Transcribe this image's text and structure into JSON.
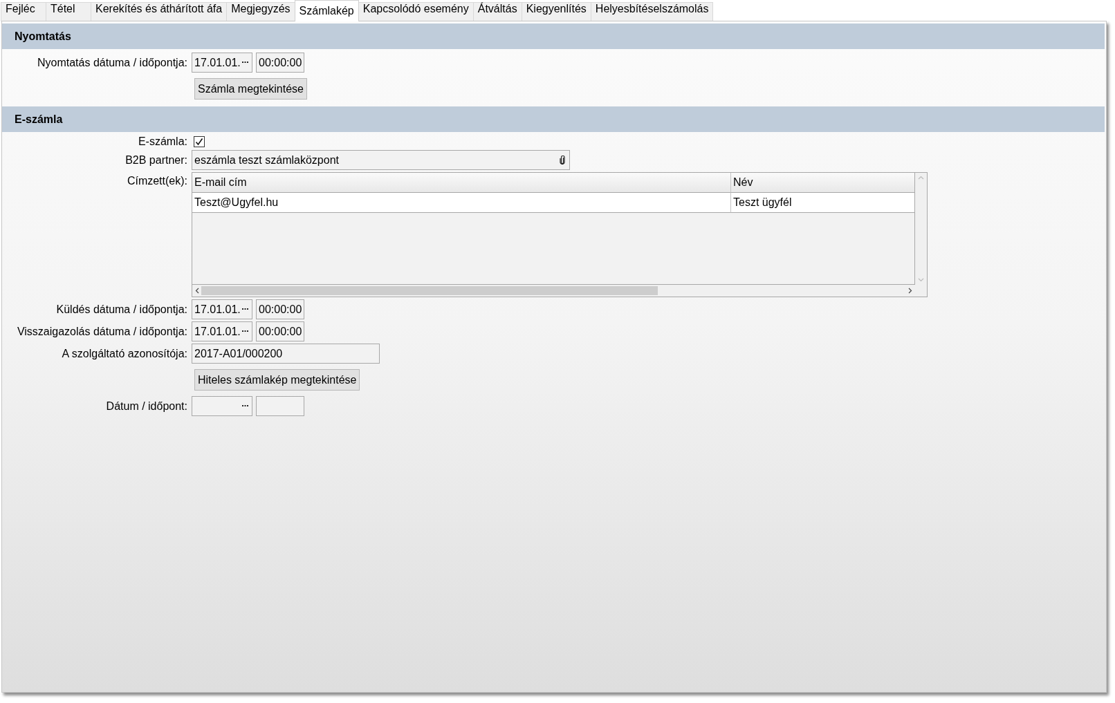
{
  "tabs": [
    {
      "label": "Fejléc",
      "selected": false
    },
    {
      "label": "Tétel",
      "selected": false
    },
    {
      "label": "Kerekítés és áthárított áfa",
      "selected": false
    },
    {
      "label": "Megjegyzés",
      "selected": false
    },
    {
      "label": "Számlakép",
      "selected": true
    },
    {
      "label": "Kapcsolódó esemény",
      "selected": false
    },
    {
      "label": "Átváltás",
      "selected": false
    },
    {
      "label": "Kiegyenlítés",
      "selected": false
    },
    {
      "label": "Helyesbítéselszámolás",
      "selected": false
    }
  ],
  "sections": [
    {
      "title": "Nyomtatás",
      "rows": [
        {
          "kind": "datetime",
          "label": "Nyomtatás dátuma / időpontja:",
          "date": "17.01.01.",
          "time": "00:00:00"
        },
        {
          "kind": "button",
          "text": "Számla megtekintése"
        }
      ]
    },
    {
      "title": "E-számla",
      "rows": [
        {
          "kind": "checkbox",
          "label": "E-számla:",
          "checked": true
        },
        {
          "kind": "lookup",
          "label": "B2B partner:",
          "value": "eszámla teszt számlaközpont"
        },
        {
          "kind": "table",
          "label": "Címzett(ek):",
          "columns": [
            "E-mail cím",
            "Név"
          ],
          "rows": [
            [
              "Teszt@Ugyfel.hu",
              "Teszt ügyfél"
            ]
          ]
        },
        {
          "kind": "datetime",
          "label": "Küldés dátuma / időpontja:",
          "date": "17.01.01.",
          "time": "00:00:00"
        },
        {
          "kind": "datetime",
          "label": "Visszaigazolás dátuma / időpontja:",
          "date": "17.01.01.",
          "time": "00:00:00"
        },
        {
          "kind": "text",
          "label": "A szolgáltató azonosítója:",
          "value": "2017-A01/000200"
        },
        {
          "kind": "button",
          "text": "Hiteles számlakép megtekintése"
        },
        {
          "kind": "datetime",
          "label": "Dátum / időpont:"
        }
      ]
    }
  ]
}
